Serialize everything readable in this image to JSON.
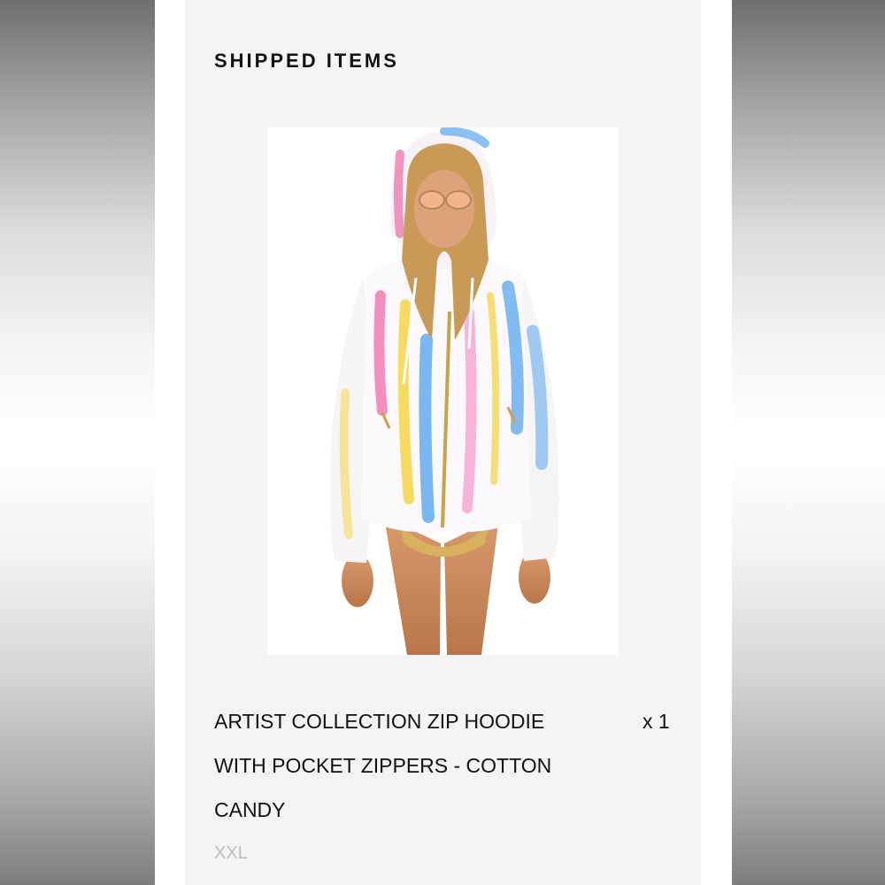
{
  "section": {
    "title": "SHIPPED ITEMS"
  },
  "item": {
    "name": "ARTIST COLLECTION ZIP HOODIE WITH POCKET ZIPPERS - COTTON CANDY",
    "quantity": "x 1",
    "size": "XXL"
  },
  "image": {
    "icon": "product-photo-icon"
  },
  "colors": {
    "card_background": "#f4f4f4",
    "text": "#111111",
    "muted_text": "#bcbcbc",
    "tie_dye": [
      "#f06aa8",
      "#5aa6ee",
      "#f5d33a",
      "#b6e0ff",
      "#f7a3cf"
    ]
  }
}
